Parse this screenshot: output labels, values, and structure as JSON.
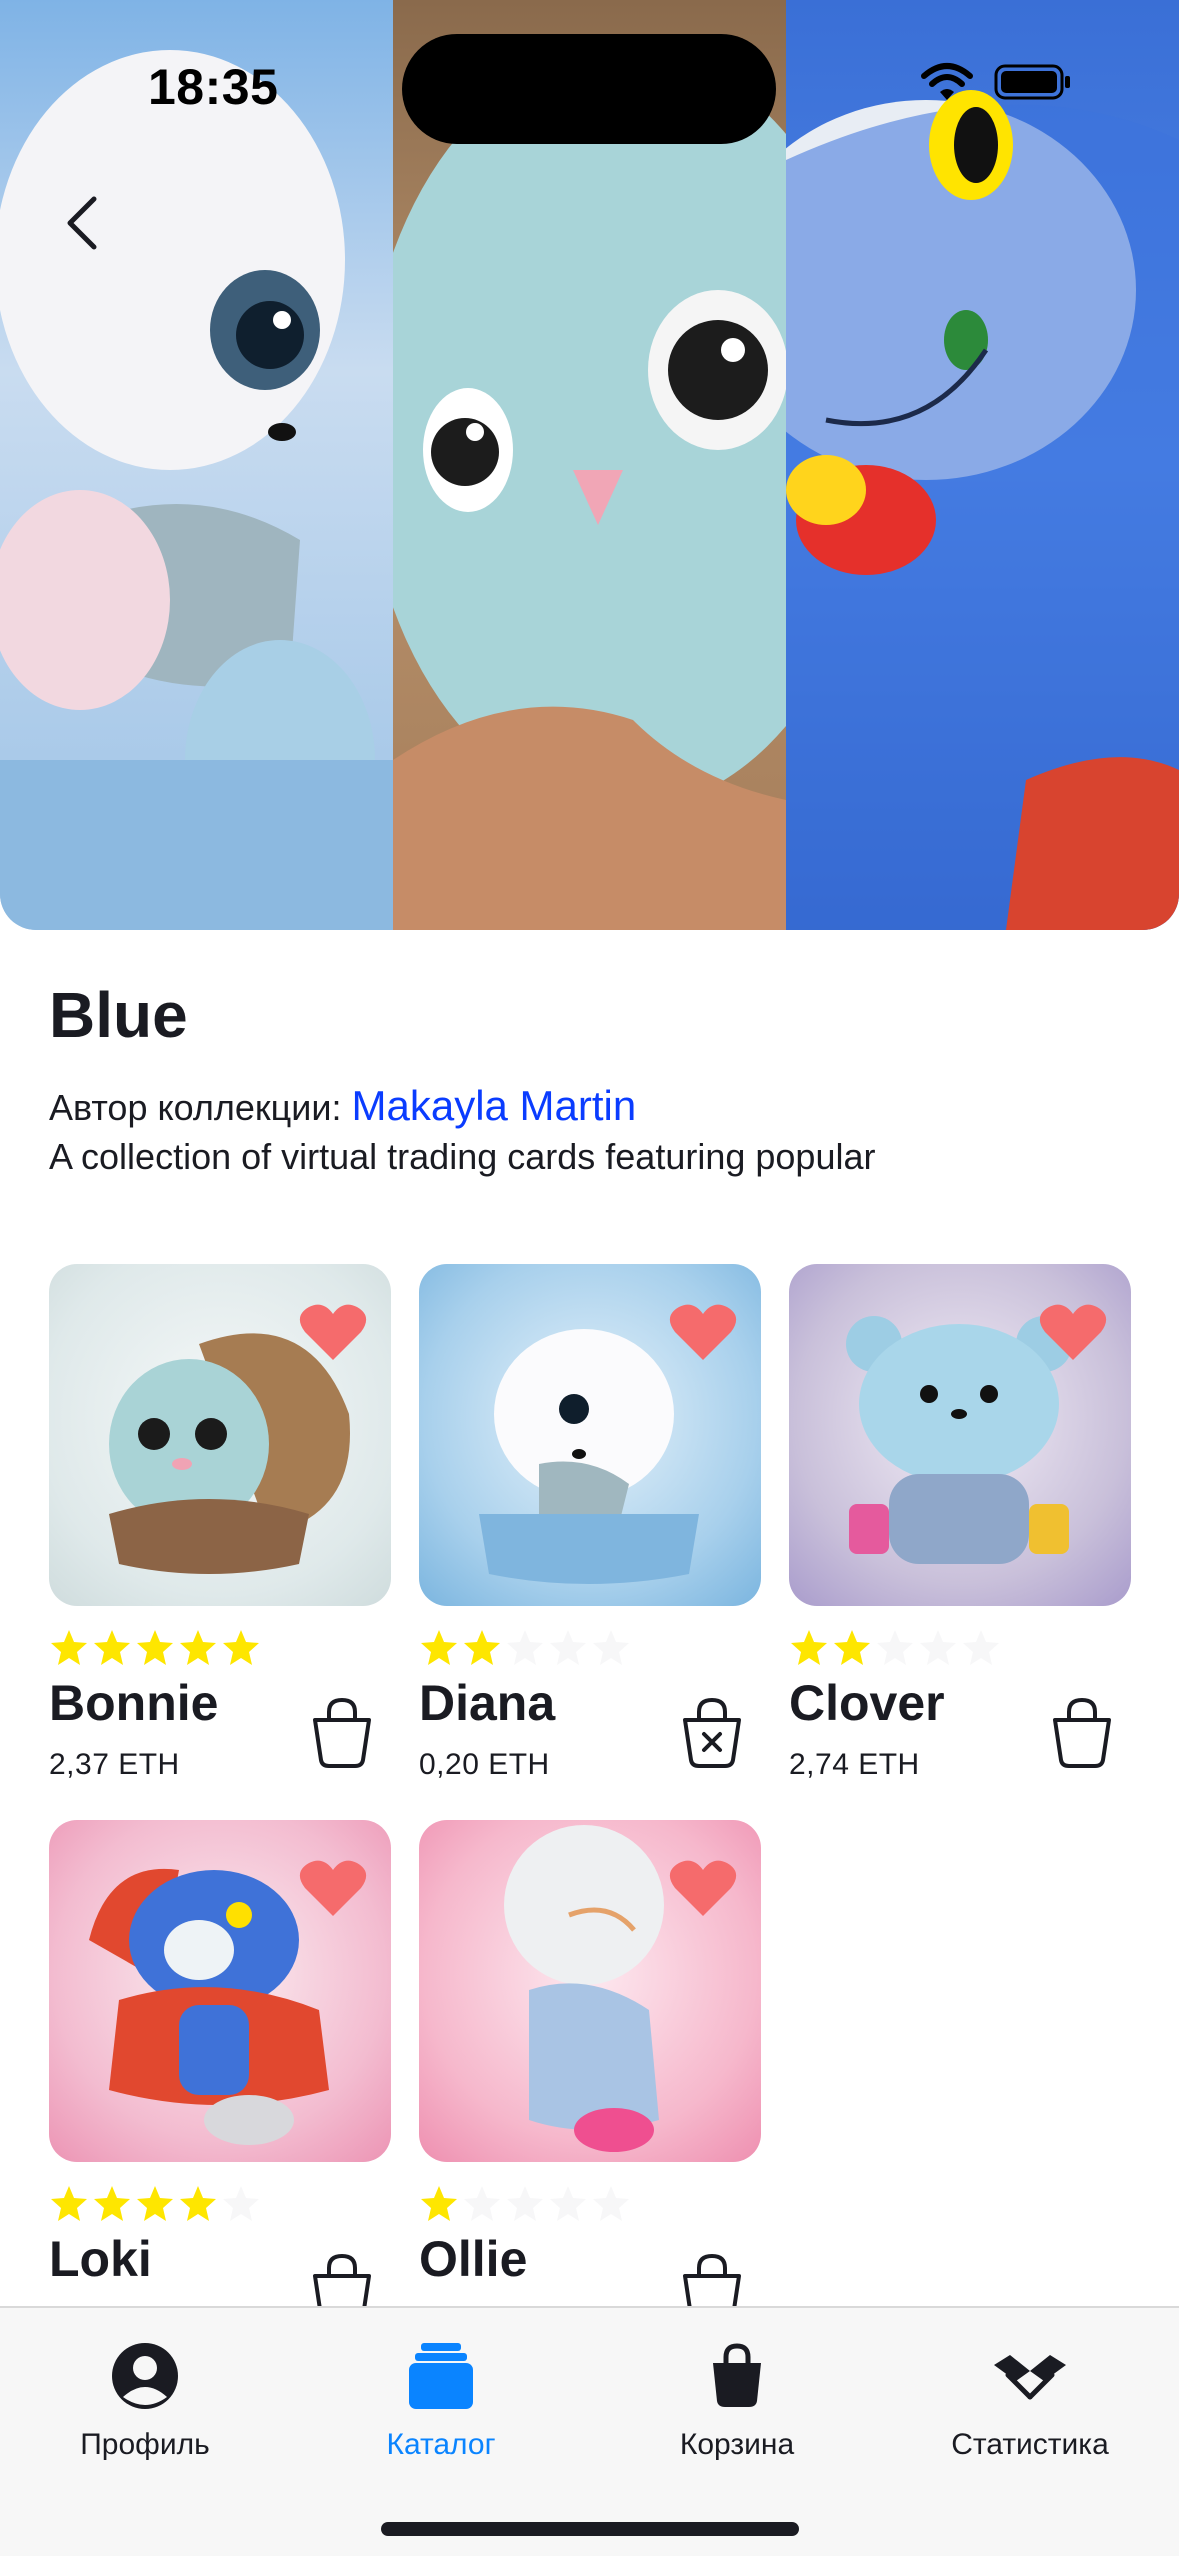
{
  "status_bar": {
    "time": "18:35"
  },
  "collection": {
    "title": "Blue",
    "author_prefix": "Автор коллекции:",
    "author_name": "Makayla Martin",
    "description": "A collection of virtual trading cards featuring popular"
  },
  "nfts": [
    {
      "name": "Bonnie",
      "price": "2,37 ETH",
      "rating": 5,
      "liked": true,
      "in_cart": false
    },
    {
      "name": "Diana",
      "price": "0,20 ETH",
      "rating": 2,
      "liked": true,
      "in_cart": true
    },
    {
      "name": "Clover",
      "price": "2,74 ETH",
      "rating": 2,
      "liked": true,
      "in_cart": false
    },
    {
      "name": "Loki",
      "price": "",
      "rating": 4,
      "liked": true,
      "in_cart": false
    },
    {
      "name": "Ollie",
      "price": "",
      "rating": 1,
      "liked": true,
      "in_cart": false
    }
  ],
  "tabs": [
    {
      "label": "Профиль",
      "icon": "profile-icon",
      "active": false
    },
    {
      "label": "Каталог",
      "icon": "catalog-icon",
      "active": true
    },
    {
      "label": "Корзина",
      "icon": "cart-icon",
      "active": false
    },
    {
      "label": "Статистика",
      "icon": "statistics-icon",
      "active": false
    }
  ],
  "colors": {
    "accent": "#0a84ff",
    "link": "#0a3cff",
    "star_active": "#fee600",
    "star_inactive": "#f7f7f8",
    "like": "#f56b6c",
    "text": "#1a1b22"
  }
}
